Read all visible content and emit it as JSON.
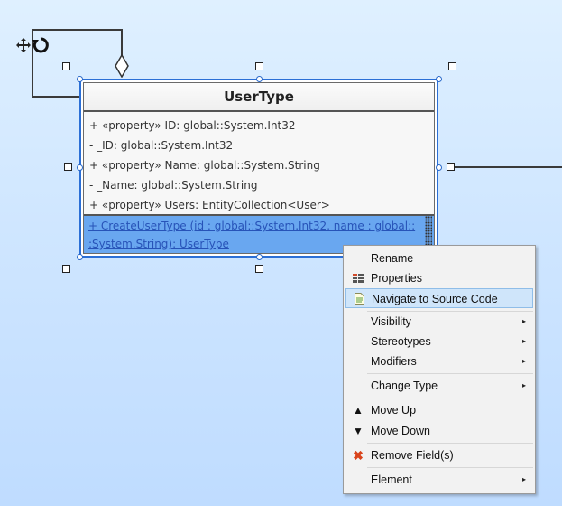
{
  "class": {
    "name": "UserType",
    "properties": [
      "+ «property» ID: global::System.Int32",
      "- _ID: global::System.Int32",
      "+ «property» Name: global::System.String",
      "- _Name: global::System.String",
      "+ «property» Users: EntityCollection<User>"
    ],
    "operation_line1": "+ CreateUserType (id : global::System.Int32, name : global::",
    "operation_line2": ":System.String): UserType"
  },
  "context_menu": {
    "items": [
      {
        "label": "Rename"
      },
      {
        "label": "Properties"
      },
      {
        "label": "Navigate to Source Code"
      },
      {
        "label": "Visibility"
      },
      {
        "label": "Stereotypes"
      },
      {
        "label": "Modifiers"
      },
      {
        "label": "Change Type"
      },
      {
        "label": "Move Up"
      },
      {
        "label": "Move Down"
      },
      {
        "label": "Remove Field(s)"
      },
      {
        "label": "Element"
      }
    ]
  },
  "colors": {
    "selection_border": "#2b6fd6",
    "operation_highlight": "#69a7f0",
    "menu_highlight": "#cfe5fa"
  }
}
